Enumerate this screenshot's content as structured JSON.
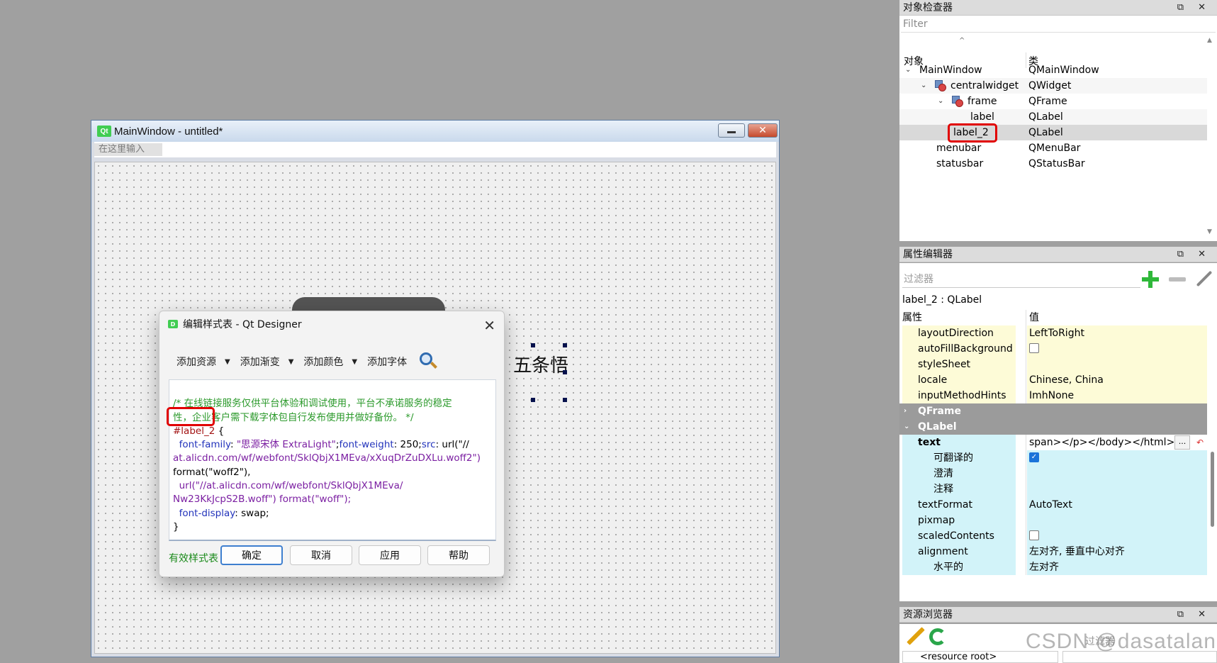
{
  "form_window": {
    "title": "MainWindow - untitled*",
    "qt_logo": "Qt",
    "menu_placeholder": "在这里输入",
    "minimize_glyph": "",
    "close_glyph": "✕"
  },
  "canvas": {
    "label2_text": "五条悟"
  },
  "dialog": {
    "title": "编辑样式表 - Qt Designer",
    "logo": "D",
    "close_glyph": "✕",
    "toolbar": {
      "add_resource": "添加资源",
      "add_gradient": "添加渐变",
      "add_color": "添加颜色",
      "add_font": "添加字体"
    },
    "code": {
      "comment1": "/* 在线链接服务仅供平台体验和调试使用，平台不承诺服务的稳定",
      "comment2": "性，企业客户需下载字体包自行发布使用并做好备份。 */",
      "selector": "#label_2",
      "open_brace": " {",
      "ff_prop": "  font-family",
      "ff_colon": ": ",
      "ff_val": "\"思源宋体 ExtraLight\"",
      "fw_sep": ";",
      "fw_prop": "font-weight",
      "fw_val": ": 250;",
      "src_prop": "src",
      "src_url1a": ": url(\"//",
      "src_url1b": "at.alicdn.com/wf/webfont/SklQbjX1MEva/xXuqDrZuDXLu.woff2\")",
      "format1": "format(\"woff2\"),",
      "url2a": "  url(\"//at.alicdn.com/wf/webfont/SklQbjX1MEva/",
      "url2b": "Nw23KkJcpS2B.woff\") format(\"woff\");",
      "fd_prop": "  font-display",
      "fd_val": ": swap;",
      "close_brace": "}"
    },
    "valid_text": "有效样式表",
    "buttons": {
      "ok": "确定",
      "cancel": "取消",
      "apply": "应用",
      "help": "帮助"
    }
  },
  "object_inspector": {
    "title": "对象检查器",
    "filter_placeholder": "Filter",
    "col_object": "对象",
    "col_class": "类",
    "sort_glyph": "^",
    "rows": [
      {
        "name": "MainWindow",
        "class": "QMainWindow"
      },
      {
        "name": "centralwidget",
        "class": "QWidget"
      },
      {
        "name": "frame",
        "class": "QFrame"
      },
      {
        "name": "label",
        "class": "QLabel"
      },
      {
        "name": "label_2",
        "class": "QLabel"
      },
      {
        "name": "menubar",
        "class": "QMenuBar"
      },
      {
        "name": "statusbar",
        "class": "QStatusBar"
      }
    ]
  },
  "property_editor": {
    "title": "属性编辑器",
    "filter_placeholder": "过滤器",
    "object_class": "label_2 : QLabel",
    "col_property": "属性",
    "col_value": "值",
    "rows": [
      {
        "name": "layoutDirection",
        "value": "LeftToRight"
      },
      {
        "name": "autoFillBackground",
        "value": ""
      },
      {
        "name": "styleSheet",
        "value": ""
      },
      {
        "name": "locale",
        "value": "Chinese, China"
      },
      {
        "name": "inputMethodHints",
        "value": "ImhNone"
      },
      {
        "name": "QFrame",
        "value": ""
      },
      {
        "name": "QLabel",
        "value": ""
      },
      {
        "name": "text",
        "value": "span></p></body></html>"
      },
      {
        "name": "可翻译的",
        "value": ""
      },
      {
        "name": "澄清",
        "value": ""
      },
      {
        "name": "注释",
        "value": ""
      },
      {
        "name": "textFormat",
        "value": "AutoText"
      },
      {
        "name": "pixmap",
        "value": ""
      },
      {
        "name": "scaledContents",
        "value": ""
      },
      {
        "name": "alignment",
        "value": "左对齐, 垂直中心对齐"
      },
      {
        "name": "水平的",
        "value": "左对齐"
      }
    ],
    "dots": "..."
  },
  "resource_browser": {
    "title": "资源浏览器",
    "filter_placeholder": "过滤器",
    "root": "<resource root>"
  },
  "panel_tools": "⧉ ✕",
  "watermark": "CSDN @dasatalan",
  "colors": {
    "highlight_red": "#e10000",
    "yellow_row": "#fdfbd7",
    "cyan_row": "#d2f3f9",
    "group_row": "#9b9b9b",
    "valid_green": "#1a8a1a"
  }
}
